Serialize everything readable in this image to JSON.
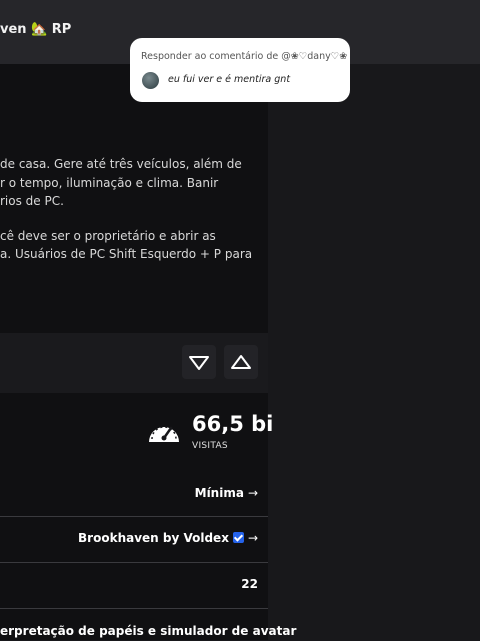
{
  "header": {
    "title": "ven 🏡 RP"
  },
  "description": {
    "lines": [
      "de casa. Gere até três veículos, além de",
      "r o tempo, iluminação e clima. Banir",
      "rios de PC.",
      "",
      "cê deve ser o proprietário e abrir as",
      "a. Usuários de PC Shift Esquerdo + P para"
    ]
  },
  "votes": {
    "down_icon": "triangle-down-icon",
    "up_icon": "triangle-up-icon"
  },
  "stats": {
    "visits_value": "66,5 bi",
    "visits_label": "VISITAS",
    "visits_icon": "speedometer-icon"
  },
  "details": {
    "maturity": "Mínima",
    "creator": "Brookhaven by Voldex",
    "max_players": "22",
    "genre": "erpretação de papéis e simulador de avatar",
    "arrow": "→"
  },
  "reply_popup": {
    "title": "Responder ao comentário de @❀♡dany♡❀",
    "comment": "eu fui ver e é mentira gnt"
  },
  "colors": {
    "background": "#18181b",
    "panel": "#101012",
    "accent_verified": "#2563eb",
    "popup_bg": "#ffffff"
  }
}
